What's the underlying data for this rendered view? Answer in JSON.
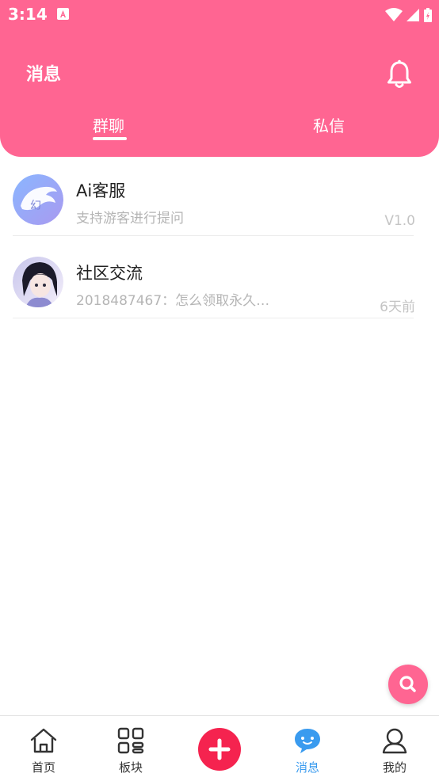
{
  "status_bar": {
    "time": "3:14"
  },
  "header": {
    "title": "消息"
  },
  "tabs": [
    {
      "label": "群聊",
      "active": true
    },
    {
      "label": "私信",
      "active": false
    }
  ],
  "chats": [
    {
      "name": "Ai客服",
      "preview": "支持游客进行提问",
      "meta": "V1.0",
      "avatar": "ai-service-avatar"
    },
    {
      "name": "社区交流",
      "preview": "2018487467：怎么领取永久…",
      "meta": "6天前",
      "avatar": "community-avatar"
    }
  ],
  "nav": [
    {
      "label": "首页",
      "icon": "home-icon"
    },
    {
      "label": "板块",
      "icon": "grid-icon"
    },
    {
      "label": "",
      "icon": "add-icon"
    },
    {
      "label": "消息",
      "icon": "chat-bubble-icon",
      "active": true
    },
    {
      "label": "我的",
      "icon": "profile-icon"
    }
  ],
  "colors": {
    "accent": "#ff6592",
    "add_button": "#f5234f",
    "nav_active": "#3a9bef"
  }
}
